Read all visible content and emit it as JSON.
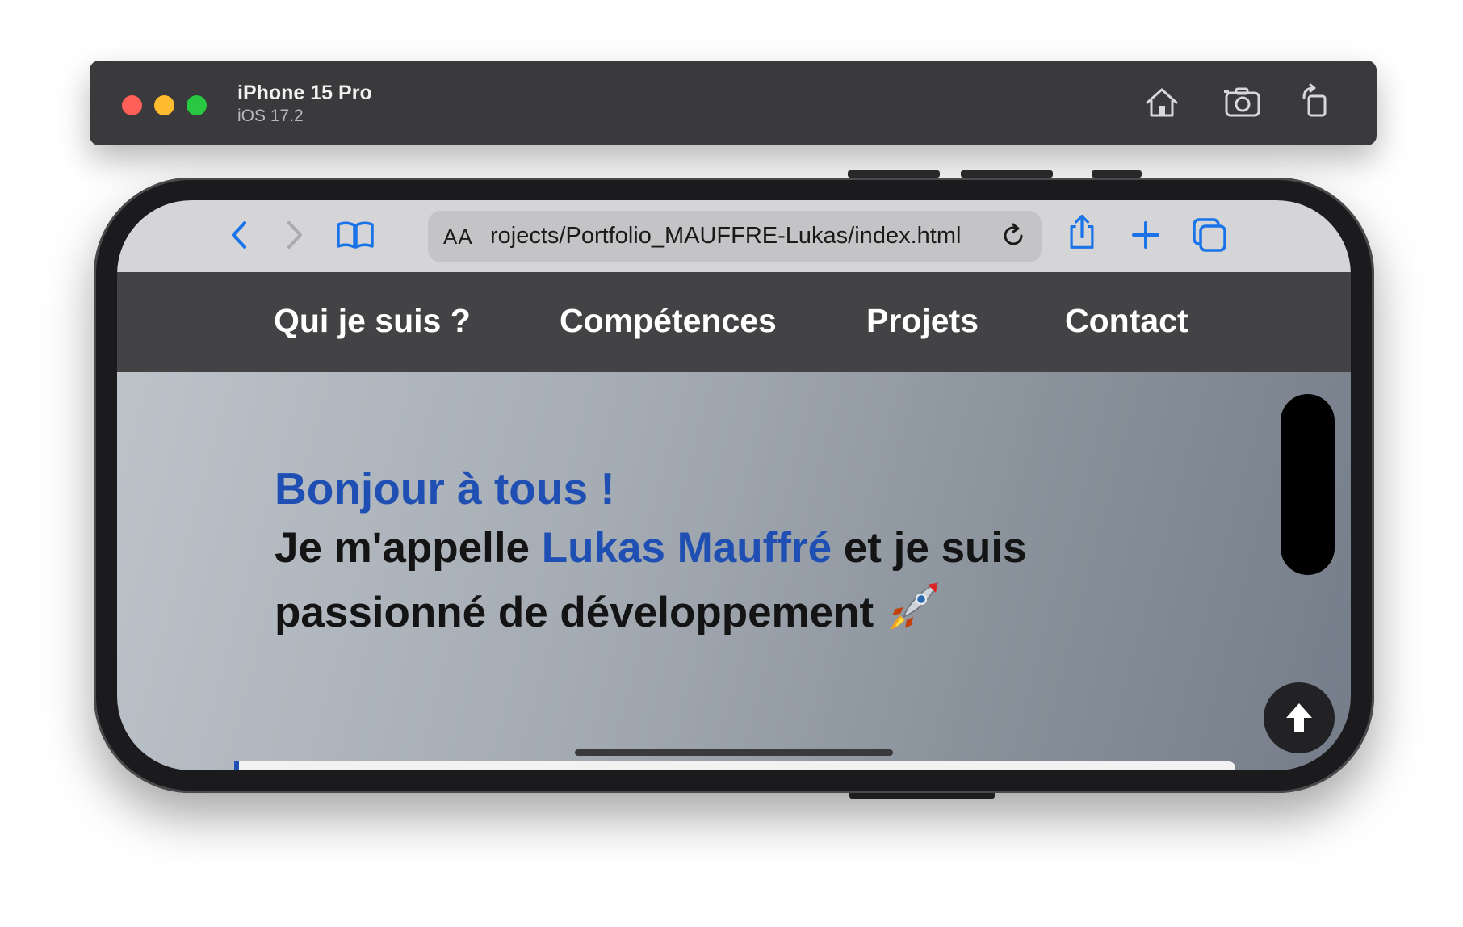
{
  "simulator": {
    "device_name": "iPhone 15 Pro",
    "os_version": "iOS 17.2",
    "icons": [
      "home-icon",
      "screenshot-camera-icon",
      "rotate-icon"
    ]
  },
  "safari": {
    "text_size_label": "AA",
    "url": "rojects/Portfolio_MAUFFRE-Lukas/index.html",
    "icons": [
      "back-chevron-icon",
      "forward-chevron-icon",
      "bookmarks-book-icon",
      "reload-icon",
      "share-icon",
      "new-tab-plus-icon",
      "tabs-icon"
    ],
    "accent_color": "#1a73e8"
  },
  "site": {
    "nav": [
      "Qui je suis ?",
      "Compétences",
      "Projets",
      "Contact"
    ],
    "hero": {
      "greeting": "Bonjour à tous !",
      "intro_before": "Je m'appelle ",
      "name": "Lukas Mauffré",
      "intro_after": " et je suis passionné de développement ",
      "emoji": "🚀"
    },
    "scroll_top_icon": "arrow-up-icon",
    "colors": {
      "nav_bg": "#434345",
      "highlight": "#1f4fb3"
    }
  }
}
